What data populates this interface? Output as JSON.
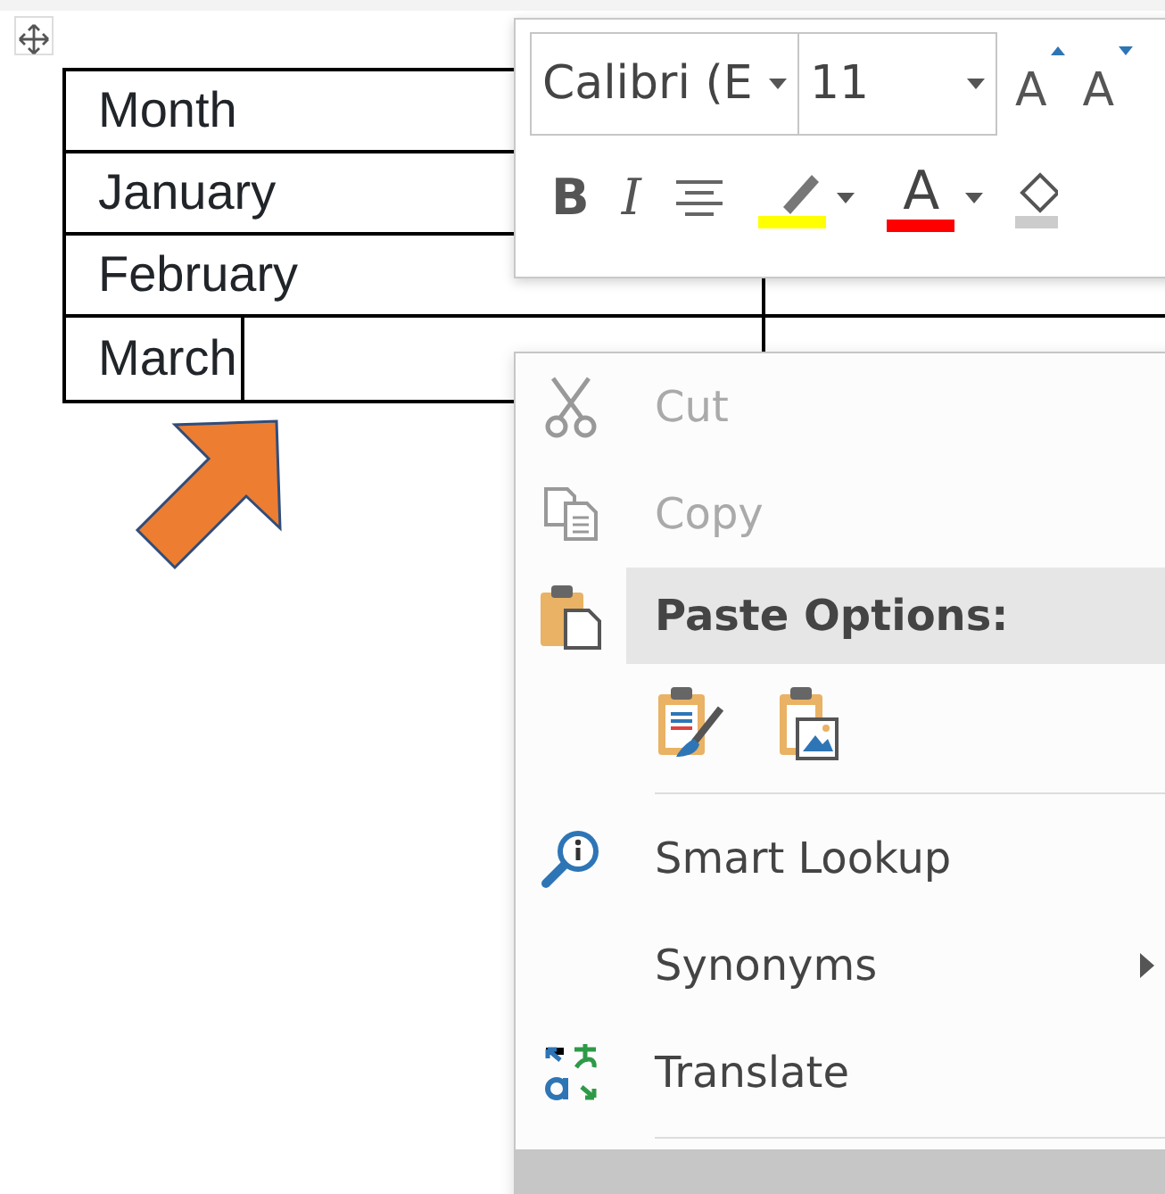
{
  "table": {
    "rows": [
      {
        "month": "Month"
      },
      {
        "month": "January"
      },
      {
        "month": "February"
      },
      {
        "month": "March"
      }
    ]
  },
  "mini_toolbar": {
    "font": "Calibri (E",
    "size": "11",
    "row_1": [
      {
        "kind": "grow_font",
        "label": "A"
      },
      {
        "kind": "shrink_font",
        "label": "A"
      }
    ],
    "row_2": [
      {
        "kind": "bold",
        "label": "B"
      },
      {
        "kind": "italic",
        "label": "I"
      },
      {
        "kind": "align"
      },
      {
        "kind": "highlight",
        "color": "#ffff00"
      },
      {
        "kind": "font_color",
        "label": "A",
        "color": "#ff0000"
      },
      {
        "kind": "shading"
      }
    ]
  },
  "context_menu": [
    {
      "kind": "cut",
      "label": "Cut",
      "disabled": true
    },
    {
      "kind": "copy",
      "label": "Copy",
      "disabled": true
    },
    {
      "kind": "header",
      "label": "Paste Options:"
    },
    {
      "kind": "paste_icons"
    },
    {
      "kind": "separator"
    },
    {
      "kind": "lookup",
      "label": "Smart Lookup",
      "disabled": false
    },
    {
      "kind": "plain",
      "label": "Synonyms",
      "disabled": false,
      "submenu": true
    },
    {
      "kind": "translate",
      "label": "Translate",
      "disabled": false
    },
    {
      "kind": "separator"
    },
    {
      "kind": "hovered_row"
    }
  ]
}
